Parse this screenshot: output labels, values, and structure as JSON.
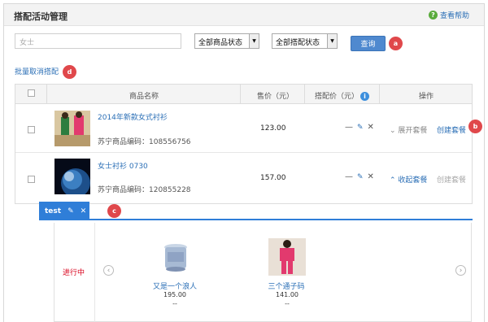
{
  "header": {
    "title": "搭配活动管理",
    "help_label": "查看帮助",
    "help_icon": "question-circle-icon"
  },
  "filters": {
    "search_value": "女士",
    "product_status": "全部商品状态",
    "bundle_status": "全部搭配状态",
    "query_label": "查询"
  },
  "batch_cancel_label": "批量取消搭配",
  "table": {
    "columns": [
      "商品名称",
      "售价（元）",
      "搭配价（元）",
      "操作"
    ],
    "rows": [
      {
        "name": "2014年新款女式衬衫",
        "code": "苏宁商品编码：108556756",
        "price": "123.00",
        "dash": "—",
        "expand_label": "展开套餐",
        "create_label": "创建套餐"
      },
      {
        "name": "女士衬衫 0730",
        "code": "苏宁商品编码：120855228",
        "price": "157.00",
        "dash": "—",
        "expand_label": "收起套餐",
        "create_label": "创建套餐"
      }
    ]
  },
  "package": {
    "tab_label": "test",
    "status": "进行中",
    "items": [
      {
        "name": "又是一个浪人",
        "price": "195.00",
        "dash": "--"
      },
      {
        "name": "三个通子码",
        "price": "141.00",
        "dash": "--"
      }
    ]
  },
  "annotations": [
    "a",
    "b",
    "c",
    "d"
  ],
  "colors": {
    "accent": "#2f7ed8",
    "link": "#2b6fb6",
    "badge": "#e0484b",
    "status": "#d9001b"
  }
}
